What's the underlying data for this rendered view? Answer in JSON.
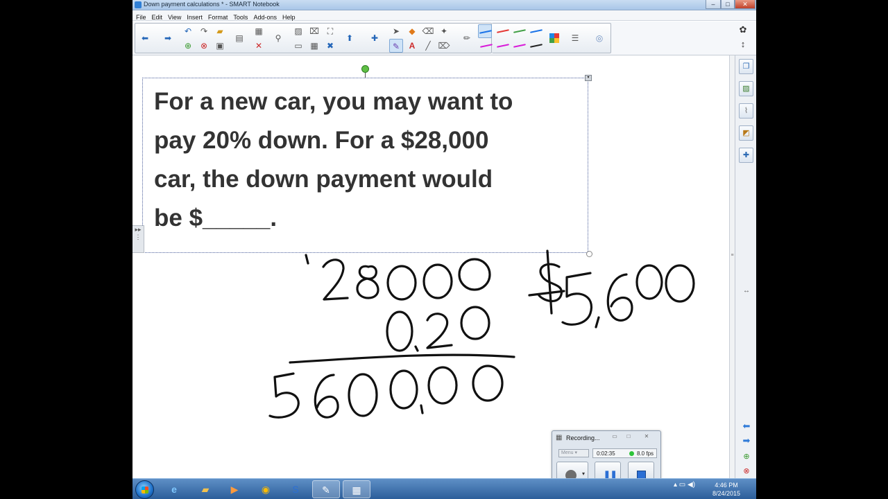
{
  "window": {
    "title": "Down payment calculations * - SMART Notebook",
    "minimize": "–",
    "maximize": "□",
    "close": "✕"
  },
  "menu": [
    "File",
    "Edit",
    "View",
    "Insert",
    "Format",
    "Tools",
    "Add-ons",
    "Help"
  ],
  "toolbar": {
    "icons": {
      "back": "arrow-left-icon",
      "forward": "arrow-right-icon",
      "undo": "undo-icon",
      "redo": "redo-icon",
      "open": "folder-icon",
      "add_page": "add-page-icon",
      "delete_page": "delete-page-icon",
      "save": "save-icon",
      "screen_shade": "screen-shade-icon",
      "delete": "delete-icon",
      "select": "pointer-icon",
      "pen": "pen-icon",
      "text": "text-icon",
      "line": "line-icon",
      "eraser": "eraser-icon",
      "color_palette": "palette-icon",
      "line_properties": "line-properties-icon",
      "fill": "fill-icon"
    },
    "text_tool_glyph": "A",
    "pen_colors": [
      "#1a73e8",
      "#e53935",
      "#43a047",
      "#1a73e8",
      "#d81bd8",
      "#d81bd8",
      "#d81bd8",
      "#222222"
    ]
  },
  "sidebar_right_top": {
    "settings_glyph": "✿",
    "move_glyph": "↕"
  },
  "canvas": {
    "text_lines": [
      "For a new car, you may want to",
      "pay 20% down.  For a $28,000",
      "car, the down payment would",
      "be $_____."
    ]
  },
  "sidebar": {
    "tabs": [
      "page-sorter-icon",
      "gallery-icon",
      "attachments-icon",
      "properties-icon",
      "add-ons-icon"
    ],
    "scroll_arrows": "↔",
    "nav": [
      "prev-page-icon",
      "next-page-icon",
      "add-page-icon",
      "delete-page-icon"
    ]
  },
  "recorder": {
    "title": "Recording...",
    "menu_label": "Menu",
    "time": "0:02:35",
    "fps": "8.0 fps",
    "status_color": "#2ec43a",
    "pause_glyph": "❚❚",
    "window_buttons": [
      "▭",
      "□",
      "✕"
    ]
  },
  "taskbar": {
    "clock_time": "4:46 PM",
    "clock_date": "8/24/2015",
    "apps": [
      "internet-explorer-icon",
      "file-explorer-icon",
      "media-player-icon",
      "chrome-icon",
      "smart-s-icon",
      "smart-notebook-icon",
      "recorder-icon"
    ]
  }
}
